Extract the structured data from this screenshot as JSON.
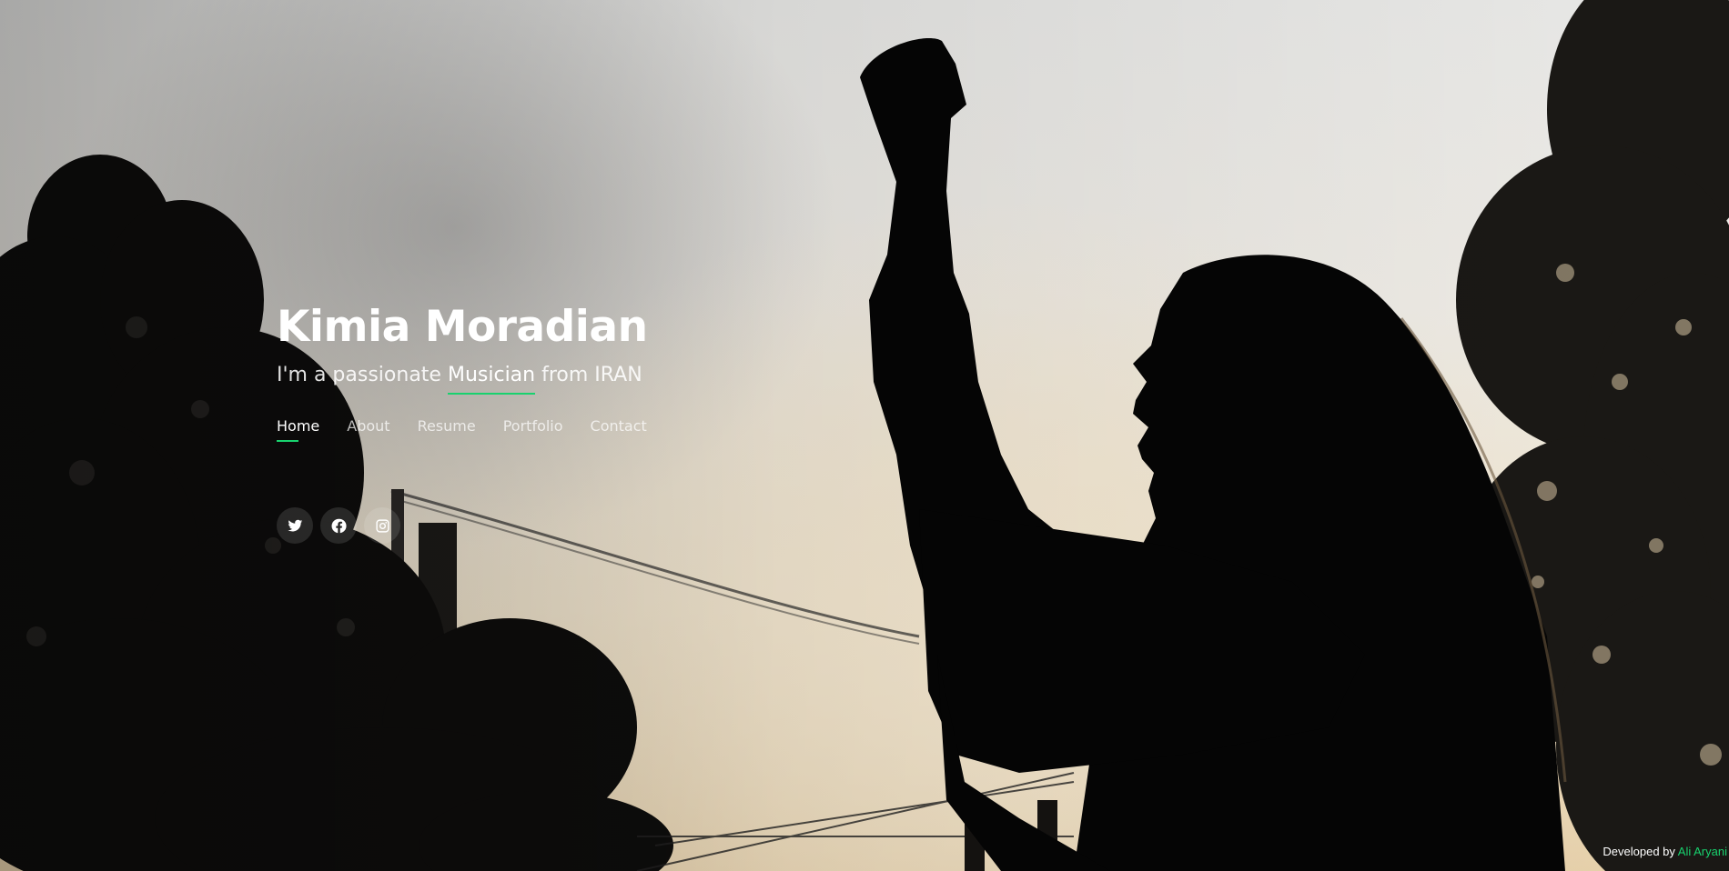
{
  "hero": {
    "name": "Kimia Moradian",
    "tagline_prefix": "I'm a passionate ",
    "tagline_highlight": "Musician",
    "tagline_suffix": " from IRAN"
  },
  "nav": {
    "items": [
      {
        "label": "Home",
        "active": true
      },
      {
        "label": "About",
        "active": false
      },
      {
        "label": "Resume",
        "active": false
      },
      {
        "label": "Portfolio",
        "active": false
      },
      {
        "label": "Contact",
        "active": false
      }
    ]
  },
  "social": {
    "icons": [
      "twitter-icon",
      "facebook-icon",
      "instagram-icon"
    ]
  },
  "credits": {
    "prefix": "Developed by ",
    "author": "Ali Aryani"
  },
  "colors": {
    "accent": "#18d26e",
    "text": "#ffffff"
  }
}
